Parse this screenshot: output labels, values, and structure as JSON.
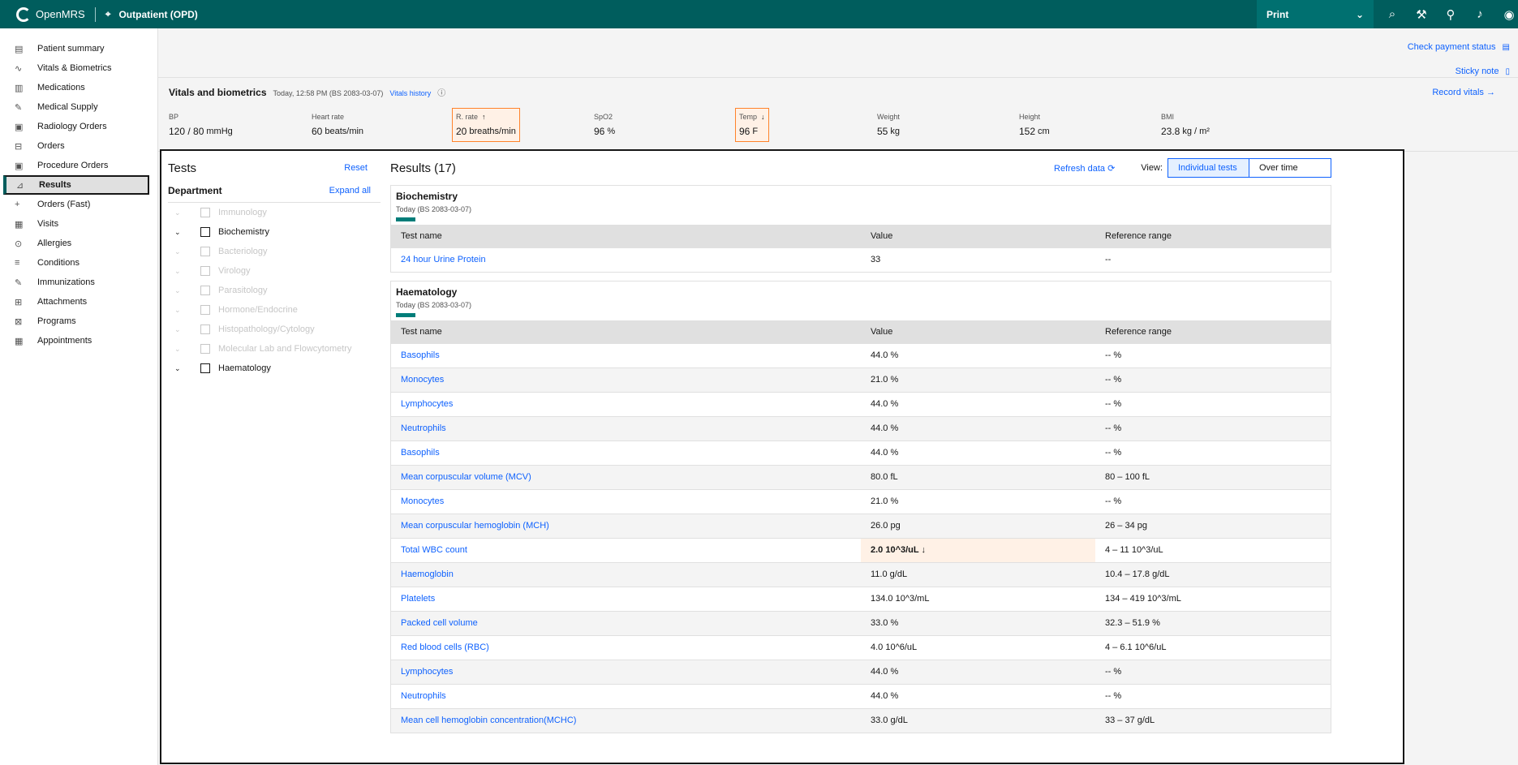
{
  "topbar": {
    "app_name": "OpenMRS",
    "location": "Outpatient (OPD)",
    "print_label": "Print",
    "icons": [
      "search-icon",
      "tools-icon",
      "add-patient-icon",
      "bell-icon",
      "user-icon"
    ]
  },
  "sidebar": {
    "items": [
      {
        "label": "Patient summary",
        "icon": "clipboard-icon"
      },
      {
        "label": "Vitals & Biometrics",
        "icon": "activity-icon"
      },
      {
        "label": "Medications",
        "icon": "pill-icon"
      },
      {
        "label": "Medical Supply",
        "icon": "syringe-icon"
      },
      {
        "label": "Radiology Orders",
        "icon": "document-icon"
      },
      {
        "label": "Orders",
        "icon": "cart-icon"
      },
      {
        "label": "Procedure Orders",
        "icon": "document-icon"
      },
      {
        "label": "Results",
        "icon": "chart-icon"
      },
      {
        "label": "Orders (Fast)",
        "icon": "plus-icon"
      },
      {
        "label": "Visits",
        "icon": "calendar-icon"
      },
      {
        "label": "Allergies",
        "icon": "warning-icon"
      },
      {
        "label": "Conditions",
        "icon": "list-icon"
      },
      {
        "label": "Immunizations",
        "icon": "syringe-icon"
      },
      {
        "label": "Attachments",
        "icon": "attachment-icon"
      },
      {
        "label": "Programs",
        "icon": "program-icon"
      },
      {
        "label": "Appointments",
        "icon": "calendar-icon"
      }
    ],
    "active": "Results"
  },
  "header_links": {
    "payment": "Check payment status",
    "sticky": "Sticky note"
  },
  "vitals": {
    "title": "Vitals and biometrics",
    "date": "Today, 12:58 PM (BS 2083-03-07)",
    "history_link": "Vitals history",
    "record_link": "Record vitals",
    "items": [
      {
        "label": "BP",
        "value": "120 / 80",
        "unit": "mmHg"
      },
      {
        "label": "Heart rate",
        "value": "60",
        "unit": "beats/min"
      },
      {
        "label": "R. rate",
        "value": "20",
        "unit": "breaths/min",
        "flag": "↑"
      },
      {
        "label": "SpO2",
        "value": "96",
        "unit": "%"
      },
      {
        "label": "Temp",
        "value": "96",
        "unit": "F",
        "flag": "↓"
      },
      {
        "label": "Weight",
        "value": "55",
        "unit": "kg"
      },
      {
        "label": "Height",
        "value": "152",
        "unit": "cm"
      },
      {
        "label": "BMI",
        "value": "23.8",
        "unit": "kg / m²"
      }
    ]
  },
  "tests": {
    "title": "Tests",
    "reset": "Reset",
    "department": "Department",
    "expand_all": "Expand all",
    "tree": [
      {
        "label": "Immunology",
        "enabled": false
      },
      {
        "label": "Biochemistry",
        "enabled": true
      },
      {
        "label": "Bacteriology",
        "enabled": false
      },
      {
        "label": "Virology",
        "enabled": false
      },
      {
        "label": "Parasitology",
        "enabled": false
      },
      {
        "label": "Hormone/Endocrine",
        "enabled": false
      },
      {
        "label": "Histopathology/Cytology",
        "enabled": false
      },
      {
        "label": "Molecular Lab and Flowcytometry",
        "enabled": false
      },
      {
        "label": "Haematology",
        "enabled": true
      }
    ]
  },
  "results": {
    "title": "Results (17)",
    "refresh": "Refresh data",
    "view_label": "View:",
    "view_individual": "Individual tests",
    "view_overtime": "Over time",
    "columns": [
      "Test name",
      "Value",
      "Reference range"
    ],
    "panels": [
      {
        "title": "Biochemistry",
        "date": "Today (BS 2083-03-07)",
        "rows": [
          {
            "name": "24 hour Urine Protein",
            "value": "33",
            "range": "--"
          }
        ]
      },
      {
        "title": "Haematology",
        "date": "Today (BS 2083-03-07)",
        "rows": [
          {
            "name": "Basophils",
            "value": "44.0 %",
            "range": "-- %"
          },
          {
            "name": "Monocytes",
            "value": "21.0 %",
            "range": "-- %"
          },
          {
            "name": "Lymphocytes",
            "value": "44.0 %",
            "range": "-- %"
          },
          {
            "name": "Neutrophils",
            "value": "44.0 %",
            "range": "-- %"
          },
          {
            "name": "Basophils",
            "value": "44.0 %",
            "range": "-- %"
          },
          {
            "name": "Mean corpuscular volume (MCV)",
            "value": "80.0 fL",
            "range": "80 – 100 fL"
          },
          {
            "name": "Monocytes",
            "value": "21.0 %",
            "range": "-- %"
          },
          {
            "name": "Mean corpuscular hemoglobin (MCH)",
            "value": "26.0 pg",
            "range": "26 – 34 pg"
          },
          {
            "name": "Total WBC count",
            "value": "2.0 10^3/uL ↓",
            "range": "4 – 11 10^3/uL",
            "flag": "low"
          },
          {
            "name": "Haemoglobin",
            "value": "11.0 g/dL",
            "range": "10.4 – 17.8 g/dL"
          },
          {
            "name": "Platelets",
            "value": "134.0 10^3/mL",
            "range": "134 – 419 10^3/mL"
          },
          {
            "name": "Packed cell volume",
            "value": "33.0 %",
            "range": "32.3 – 51.9 %"
          },
          {
            "name": "Red blood cells (RBC)",
            "value": "4.0 10^6/uL",
            "range": "4 – 6.1 10^6/uL"
          },
          {
            "name": "Lymphocytes",
            "value": "44.0 %",
            "range": "-- %"
          },
          {
            "name": "Neutrophils",
            "value": "44.0 %",
            "range": "-- %"
          },
          {
            "name": "Mean cell hemoglobin concentration(MCHC)",
            "value": "33.0 g/dL",
            "range": "33 – 37 g/dL"
          }
        ]
      }
    ]
  }
}
